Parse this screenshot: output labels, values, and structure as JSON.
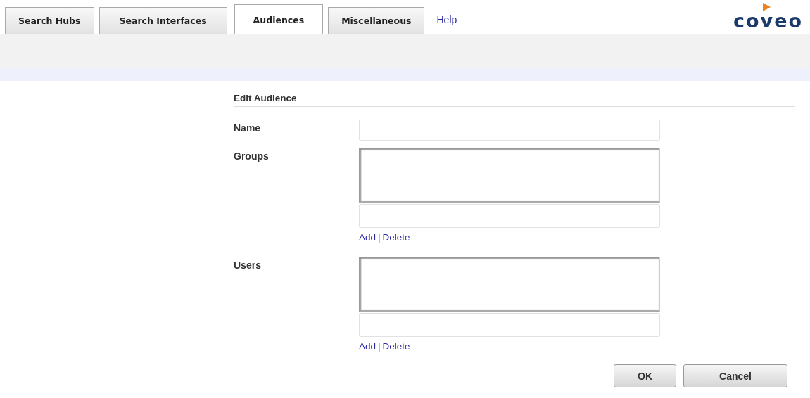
{
  "tabs": [
    {
      "label": "Search Hubs",
      "selected": false
    },
    {
      "label": "Search Interfaces",
      "selected": false
    },
    {
      "label": "Audiences",
      "selected": true
    },
    {
      "label": "Miscellaneous",
      "selected": false
    }
  ],
  "help_link": "Help",
  "logo": "coveo",
  "form": {
    "title": "Edit Audience",
    "fields": [
      {
        "kind": "text",
        "label": "Name"
      },
      {
        "kind": "list",
        "label": "Groups",
        "add": "Add",
        "separator": "|",
        "delete": "Delete"
      },
      {
        "kind": "list",
        "label": "Users",
        "add": "Add",
        "separator": "|",
        "delete": "Delete"
      }
    ],
    "buttons": [
      "OK",
      "Cancel"
    ]
  }
}
